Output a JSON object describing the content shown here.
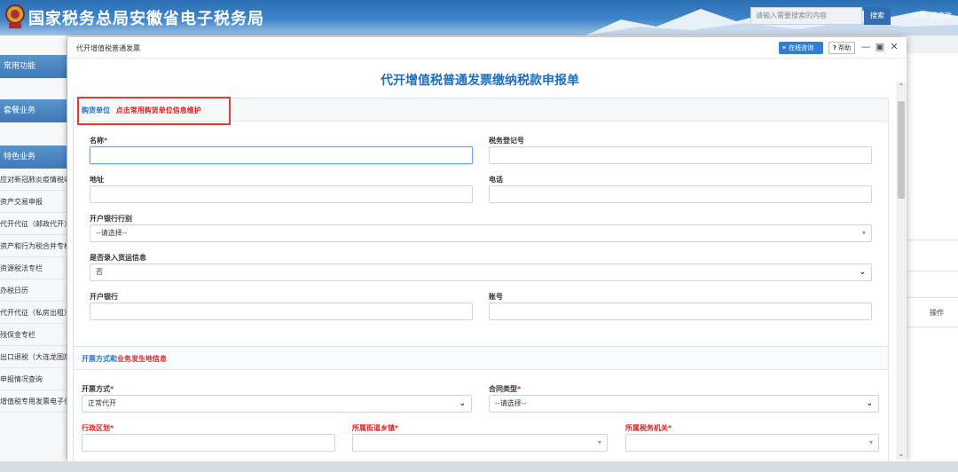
{
  "header": {
    "title": "国家税务总局安徽省电子税务局",
    "search_placeholder": "请输入需要搜索的内容",
    "search_button": "搜索",
    "welcome": "欢迎, 吕文政"
  },
  "sidebar": {
    "sections": [
      "常用功能",
      "套餐业务",
      "特色业务"
    ],
    "items": [
      "应对新冠肺炎疫情税收",
      "资产交易申报",
      "代开代征（邮政代开）",
      "资产和行为税合并专栏",
      "资源税法专栏",
      "办税日历",
      "代开代征（私房出租）",
      "残保金专栏",
      "出口退税（大连龙图版）",
      "申报情况查询",
      "增值税专用发票电子化"
    ]
  },
  "background": {
    "op_label": "操作"
  },
  "dialog": {
    "title": "代开增值税普通发票",
    "consult_button": "在线咨询",
    "help_button": "帮助",
    "form_title": "代开增值税普通发票缴纳税款申报单",
    "buyer": {
      "head_part1": "购货单位",
      "head_part2": "点击常用购货单位信息维护",
      "name_label": "名称",
      "tax_reg_label": "税务登记号",
      "address_label": "地址",
      "phone_label": "电话",
      "bank_type_label": "开户银行行别",
      "bank_type_value": "--请选择--",
      "cargo_label": "是否录入货运信息",
      "cargo_value": "否",
      "bank_label": "开户银行",
      "account_label": "账号"
    },
    "invoice": {
      "head_part1": "开票方式和",
      "head_part2": "业务发生地信息",
      "method_label": "开票方式",
      "method_value": "正常代开",
      "contract_label": "合同类型",
      "contract_value": "--请选择--",
      "region_label": "行政区划",
      "street_label": "所属街道乡镇",
      "tax_office_label": "所属税务机关"
    }
  },
  "colors": {
    "accent": "#1f73c9",
    "required": "#e02020",
    "header_bg": "#2c6fb4"
  }
}
